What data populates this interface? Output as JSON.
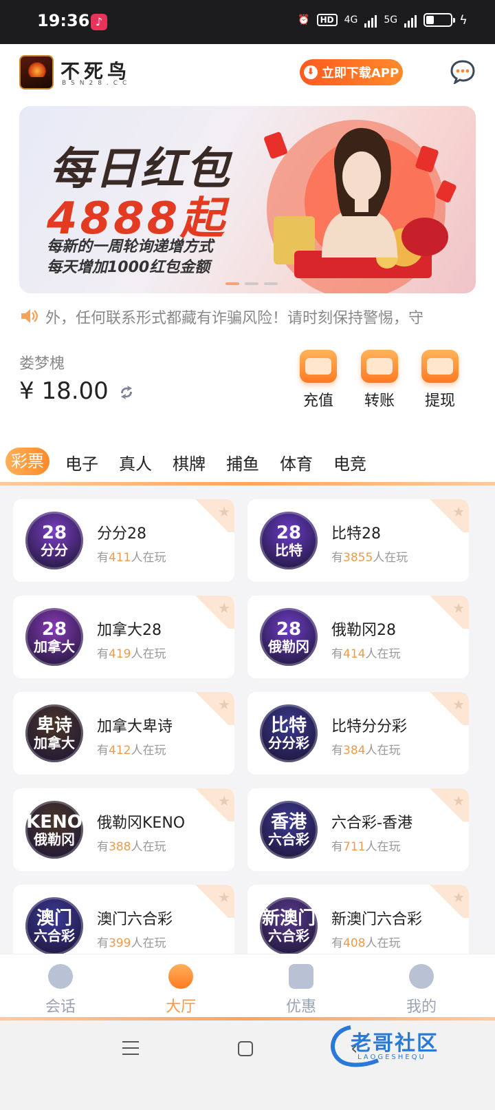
{
  "status_bar": {
    "time": "19:36",
    "hd": "HD",
    "net1": "4G",
    "net2": "5G",
    "battery_percent": 30
  },
  "header": {
    "logo_title": "不死鸟",
    "logo_sub": "BSN28.CC",
    "download_label": "立即下载APP",
    "download_icon": "download-icon",
    "chat_icon": "chat-bubble-icon"
  },
  "banner": {
    "line1": "每日红包",
    "line2": "4888起",
    "line3": "每新的一周轮询递增方式",
    "line4": "每天增加1000红包金额",
    "slides": 3,
    "active_slide": 0
  },
  "notice": {
    "icon": "speaker-icon",
    "text": "外，任何联系形式都藏有诈骗风险！请时刻保持警惕，守"
  },
  "account": {
    "user_name": "娄梦槐",
    "balance": "¥ 18.00",
    "refresh_icon": "refresh-icon"
  },
  "actions": [
    {
      "label": "充值",
      "icon": "wallet-icon"
    },
    {
      "label": "转账",
      "icon": "transfer-icon"
    },
    {
      "label": "提现",
      "icon": "card-icon"
    }
  ],
  "tabs": [
    "彩票",
    "电子",
    "真人",
    "棋牌",
    "捕鱼",
    "体育",
    "电竞"
  ],
  "games": [
    {
      "icon_t1": "28",
      "icon_t2": "分分",
      "name": "分分28",
      "prefix": "有",
      "count": "411",
      "suffix": "人在玩",
      "color": "#7b3fc4"
    },
    {
      "icon_t1": "28",
      "icon_t2": "比特",
      "name": "比特28",
      "prefix": "有",
      "count": "3855",
      "suffix": "人在玩",
      "color": "#6a3cc8"
    },
    {
      "icon_t1": "28",
      "icon_t2": "加拿大",
      "name": "加拿大28",
      "prefix": "有",
      "count": "419",
      "suffix": "人在玩",
      "color": "#8a3bb8"
    },
    {
      "icon_t1": "28",
      "icon_t2": "俄勒冈",
      "name": "俄勒冈28",
      "prefix": "有",
      "count": "414",
      "suffix": "人在玩",
      "color": "#6e3ec6"
    },
    {
      "icon_t1": "卑诗",
      "icon_t2": "加拿大",
      "name": "加拿大卑诗",
      "prefix": "有",
      "count": "412",
      "suffix": "人在玩",
      "color": "#4a3626"
    },
    {
      "icon_t1": "比特",
      "icon_t2": "分分彩",
      "name": "比特分分彩",
      "prefix": "有",
      "count": "384",
      "suffix": "人在玩",
      "color": "#3a3a8e"
    },
    {
      "icon_t1": "KENO",
      "icon_t2": "俄勒冈",
      "name": "俄勒冈KENO",
      "prefix": "有",
      "count": "388",
      "suffix": "人在玩",
      "color": "#4a3828"
    },
    {
      "icon_t1": "香港",
      "icon_t2": "六合彩",
      "name": "六合彩-香港",
      "prefix": "有",
      "count": "711",
      "suffix": "人在玩",
      "color": "#3c3a92"
    },
    {
      "icon_t1": "澳门",
      "icon_t2": "六合彩",
      "name": "澳门六合彩",
      "prefix": "有",
      "count": "399",
      "suffix": "人在玩",
      "color": "#3b3a9a"
    },
    {
      "icon_t1": "新澳门",
      "icon_t2": "六合彩",
      "name": "新澳门六合彩",
      "prefix": "有",
      "count": "408",
      "suffix": "人在玩",
      "color": "#5a3a8c"
    }
  ],
  "bottom_nav": [
    {
      "label": "会话",
      "icon": "chat-icon",
      "active": false
    },
    {
      "label": "大厅",
      "icon": "hall-icon",
      "active": true
    },
    {
      "label": "优惠",
      "icon": "coupon-icon",
      "active": false
    },
    {
      "label": "我的",
      "icon": "user-icon",
      "active": false
    }
  ],
  "watermark": {
    "text": "老哥社区",
    "sub": "LAOGESHEQU"
  },
  "colors": {
    "accent": "#ff7a22",
    "accent_light": "#ffb05a",
    "count": "#f09a4a"
  }
}
